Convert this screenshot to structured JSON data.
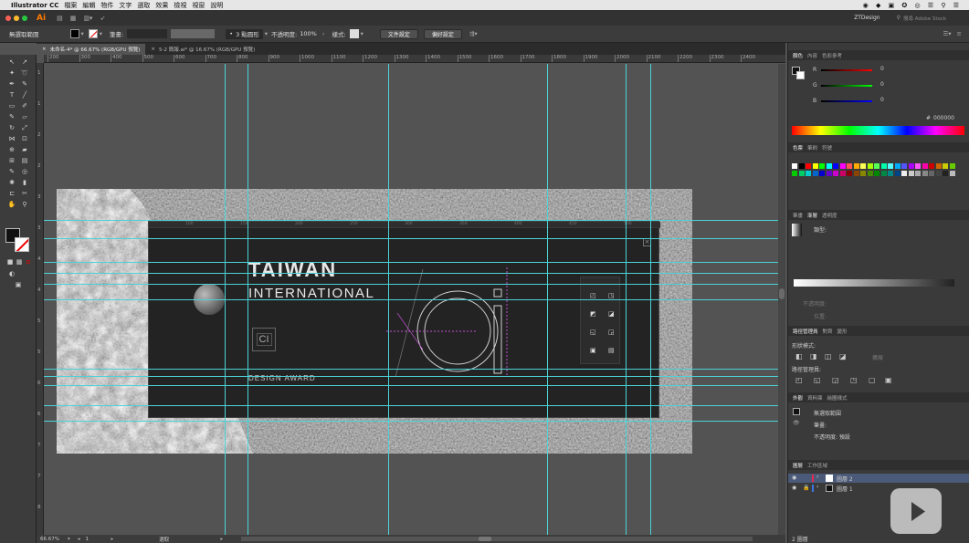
{
  "menubar": {
    "apple": "",
    "items": [
      "Illustrator CC",
      "檔案",
      "編輯",
      "物件",
      "文字",
      "選取",
      "效果",
      "檢視",
      "視窗",
      "說明"
    ]
  },
  "appbar": {
    "logo": "Ai",
    "workspace": "ZTDesign",
    "search_placeholder": "搜尋 Adobe Stock"
  },
  "controlbar": {
    "selection_label": "無選取範圍",
    "stroke_label": "筆畫:",
    "brush_label": "3 點圓形",
    "opacity_label": "不透明度:",
    "opacity_value": "100%",
    "style_label": "樣式:",
    "doc_setup_button": "文件設定",
    "prefs_button": "偏好設定"
  },
  "doc_tabs": [
    {
      "label": "未命名-4* @ 66.67% (RGB/GPU 預覽)",
      "active": true
    },
    {
      "label": "5-2 簡報.ai* @ 16.67% (RGB/GPU 預覽)",
      "active": false
    }
  ],
  "ruler_h_ticks": [
    "200",
    "300",
    "400",
    "500",
    "600",
    "700",
    "800",
    "900",
    "1000",
    "1100",
    "1200",
    "1300",
    "1400",
    "1500",
    "1600",
    "1700",
    "1800",
    "1900",
    "2000",
    "2100",
    "2200",
    "2300",
    "2400"
  ],
  "ruler_v_ticks": [
    "1",
    "1",
    "2",
    "2",
    "3",
    "3",
    "4",
    "4",
    "5",
    "5",
    "6",
    "6",
    "7",
    "7",
    "8"
  ],
  "artwork": {
    "title_line1": "TAIWAN",
    "title_line2": "INTERNATIONAL",
    "logo_text": "CI",
    "subtitle": "DESIGN AWARD",
    "big_glyph": "ci",
    "inner_ruler_ticks": [
      "100",
      "150",
      "200",
      "250",
      "300",
      "350",
      "400",
      "450",
      "500"
    ]
  },
  "statusbar": {
    "zoom": "66.67%",
    "artboard": "1",
    "tool": "選取"
  },
  "panels": {
    "color_tabs": [
      "顏色",
      "內容",
      "色彩參考"
    ],
    "rgb": [
      {
        "channel": "R",
        "value": "0"
      },
      {
        "channel": "G",
        "value": "0"
      },
      {
        "channel": "B",
        "value": "0"
      }
    ],
    "hex_label": "#",
    "hex_value": "000000",
    "swatch_tabs": [
      "色票",
      "筆刷",
      "符號"
    ],
    "stroke_tabs": [
      "筆畫",
      "漸層",
      "透明度"
    ],
    "gradient_type_label": "類型:",
    "gradient_opacity_label": "不透明度:",
    "gradient_position_label": "位置:",
    "pathfinder_tabs": [
      "路徑管理員",
      "對齊",
      "變形"
    ],
    "shape_modes_label": "形狀模式:",
    "expand_button": "擴展",
    "pathfinders_label": "路徑管理員:",
    "appearance_tabs": [
      "外觀",
      "資料庫",
      "繪圖樣式"
    ],
    "appearance_title": "無選取範圍",
    "appearance_stroke": "筆畫:",
    "appearance_opacity": "不透明度: 預設",
    "layers_tabs": [
      "圖層",
      "工作區域"
    ],
    "layers": [
      {
        "name": "圖層 2",
        "color": "#e6284f",
        "selected": true
      },
      {
        "name": "圖層 1",
        "color": "#3a76e6",
        "selected": false
      }
    ],
    "layers_count": "2 圖層"
  },
  "colors": {
    "guide": "#4bd3d6",
    "accent": "#e6284f"
  }
}
